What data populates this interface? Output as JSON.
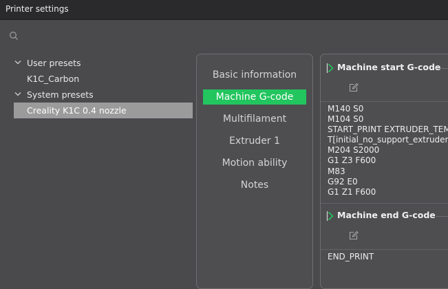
{
  "window": {
    "title": "Printer settings"
  },
  "search": {
    "icon": "search-icon"
  },
  "presets": {
    "groups": [
      {
        "label": "User presets",
        "items": [
          "K1C_Carbon"
        ]
      },
      {
        "label": "System presets",
        "items": [
          "Creality K1C 0.4 nozzle"
        ]
      }
    ],
    "selected": "Creality K1C 0.4 nozzle"
  },
  "nav": {
    "items": [
      "Basic information",
      "Machine G-code",
      "Multifilament",
      "Extruder 1",
      "Motion ability",
      "Notes"
    ],
    "active": "Machine G-code",
    "active_color": "#22c55e"
  },
  "gcode": {
    "start": {
      "title": "Machine start G-code",
      "lines": [
        "M140 S0",
        "M104 S0",
        "START_PRINT EXTRUDER_TEM",
        "T[initial_no_support_extruder]",
        "M204 S2000",
        "G1 Z3 F600",
        "M83",
        "G92 E0",
        "G1 Z1 F600"
      ]
    },
    "end": {
      "title": "Machine end G-code",
      "lines": [
        "END_PRINT"
      ]
    }
  }
}
